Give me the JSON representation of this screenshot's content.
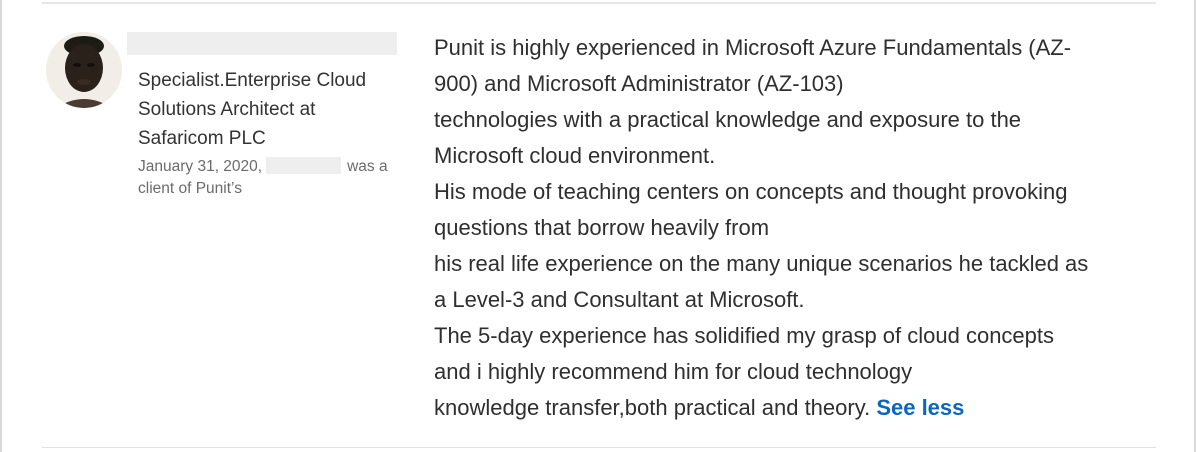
{
  "recommendation": {
    "author": {
      "headline": [
        "Specialist.Enterprise Cloud",
        "Solutions Architect at",
        "Safaricom PLC"
      ],
      "date": "January 31, 2020,",
      "relationship_suffix": "was a",
      "relationship_line2": "client of Punit’s"
    },
    "text_lines": [
      "Punit is highly experienced in Microsoft Azure Fundamentals (AZ-",
      "900) and Microsoft Administrator (AZ-103)",
      "technologies with a practical knowledge and exposure to the",
      "Microsoft cloud environment.",
      "His mode of teaching centers on concepts and thought provoking",
      "questions that borrow heavily from",
      "his real life experience on the many unique scenarios he tackled as",
      "a Level-3 and Consultant at Microsoft.",
      "The 5-day experience has solidified my grasp of cloud concepts",
      "and i highly recommend him for cloud technology",
      "knowledge transfer,both practical and theory."
    ],
    "see_less_label": "See less",
    "link_color": "#0a66c2"
  }
}
